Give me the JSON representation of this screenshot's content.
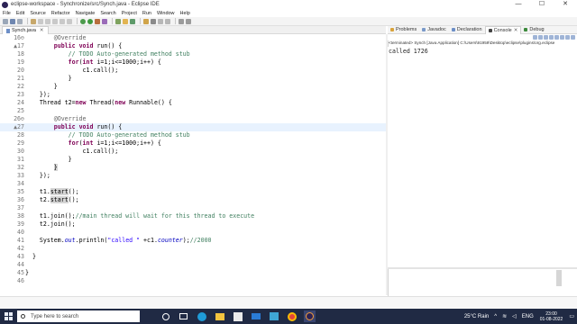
{
  "window": {
    "title": "eclipse-workspace - Synchronize/src/Synch.java - Eclipse IDE",
    "controls": [
      "—",
      "☐",
      "✕"
    ]
  },
  "menubar": [
    "File",
    "Edit",
    "Source",
    "Refactor",
    "Navigate",
    "Search",
    "Project",
    "Run",
    "Window",
    "Help"
  ],
  "editor": {
    "tab_label": "Synch.java",
    "tab_close": "✕",
    "lines": [
      {
        "num": "16⊖",
        "indent": "        ",
        "segs": [
          {
            "t": "@Override",
            "c": "ann"
          }
        ]
      },
      {
        "num": "▲17",
        "indent": "        ",
        "segs": [
          {
            "t": "public",
            "c": "kw"
          },
          {
            "t": " "
          },
          {
            "t": "void",
            "c": "kw"
          },
          {
            "t": " run() {"
          }
        ]
      },
      {
        "num": "18",
        "indent": "            ",
        "segs": [
          {
            "t": "// TODO Auto-generated method stub",
            "c": "cmt"
          }
        ]
      },
      {
        "num": "19",
        "indent": "            ",
        "segs": [
          {
            "t": "for",
            "c": "kw"
          },
          {
            "t": "("
          },
          {
            "t": "int",
            "c": "kw"
          },
          {
            "t": " i=1;i<=1000;i++) {"
          }
        ]
      },
      {
        "num": "20",
        "indent": "                ",
        "segs": [
          {
            "t": "c1.call();"
          }
        ]
      },
      {
        "num": "21",
        "indent": "            ",
        "segs": [
          {
            "t": "}"
          }
        ]
      },
      {
        "num": "22",
        "indent": "        ",
        "segs": [
          {
            "t": "}"
          }
        ]
      },
      {
        "num": "23",
        "indent": "    ",
        "segs": [
          {
            "t": "});"
          }
        ]
      },
      {
        "num": "24",
        "indent": "    ",
        "segs": [
          {
            "t": "Thread t2="
          },
          {
            "t": "new",
            "c": "kw"
          },
          {
            "t": " Thread("
          },
          {
            "t": "new",
            "c": "kw"
          },
          {
            "t": " Runnable() {"
          }
        ]
      },
      {
        "num": "25",
        "indent": "",
        "segs": []
      },
      {
        "num": "26⊖",
        "indent": "        ",
        "segs": [
          {
            "t": "@Override",
            "c": "ann"
          }
        ]
      },
      {
        "num": "▲27",
        "indent": "        ",
        "segs": [
          {
            "t": "public",
            "c": "kw"
          },
          {
            "t": " "
          },
          {
            "t": "void",
            "c": "kw"
          },
          {
            "t": " run() {"
          }
        ]
      },
      {
        "num": "28",
        "indent": "            ",
        "segs": [
          {
            "t": "// TODO Auto-generated method stub",
            "c": "cmt"
          }
        ]
      },
      {
        "num": "29",
        "indent": "            ",
        "segs": [
          {
            "t": "for",
            "c": "kw"
          },
          {
            "t": "("
          },
          {
            "t": "int",
            "c": "kw"
          },
          {
            "t": " i=1;i<=1000;i++) {"
          }
        ]
      },
      {
        "num": "30",
        "indent": "                ",
        "segs": [
          {
            "t": "c1.call();"
          }
        ]
      },
      {
        "num": "31",
        "indent": "            ",
        "segs": [
          {
            "t": "}"
          }
        ]
      },
      {
        "num": "32",
        "indent": "        ",
        "segs": [
          {
            "t": "}",
            "c": "hl"
          }
        ]
      },
      {
        "num": "33",
        "indent": "    ",
        "segs": [
          {
            "t": "});"
          }
        ]
      },
      {
        "num": "34",
        "indent": "",
        "segs": []
      },
      {
        "num": "35",
        "indent": "    ",
        "segs": [
          {
            "t": "t1."
          },
          {
            "t": "start",
            "c": "hl"
          },
          {
            "t": "();"
          }
        ]
      },
      {
        "num": "36",
        "indent": "    ",
        "segs": [
          {
            "t": "t2."
          },
          {
            "t": "start",
            "c": "hl"
          },
          {
            "t": "();"
          }
        ]
      },
      {
        "num": "37",
        "indent": "",
        "segs": []
      },
      {
        "num": "38",
        "indent": "    ",
        "segs": [
          {
            "t": "t1.join();"
          },
          {
            "t": "//main thread will wait for this thread to execute",
            "c": "cmt"
          }
        ]
      },
      {
        "num": "39",
        "indent": "    ",
        "segs": [
          {
            "t": "t2.join();"
          }
        ]
      },
      {
        "num": "40",
        "indent": "",
        "segs": []
      },
      {
        "num": "41",
        "indent": "    ",
        "segs": [
          {
            "t": "System."
          },
          {
            "t": "out",
            "c": "fld"
          },
          {
            "t": ".println("
          },
          {
            "t": "\"called \"",
            "c": "str"
          },
          {
            "t": " +c1."
          },
          {
            "t": "counter",
            "c": "fld"
          },
          {
            "t": ");"
          },
          {
            "t": "//2000",
            "c": "cmt"
          }
        ]
      },
      {
        "num": "42",
        "indent": "",
        "segs": []
      },
      {
        "num": "43",
        "indent": "  ",
        "segs": [
          {
            "t": "}"
          }
        ]
      },
      {
        "num": "44",
        "indent": "",
        "segs": []
      },
      {
        "num": "45",
        "indent": "}",
        "segs": []
      },
      {
        "num": "46",
        "indent": "",
        "segs": []
      }
    ]
  },
  "views": {
    "tabs": [
      {
        "label": "Problems",
        "icon_color": "#d9a33b",
        "active": false
      },
      {
        "label": "Javadoc",
        "icon_color": "#7a9ac9",
        "active": false
      },
      {
        "label": "Declaration",
        "icon_color": "#6d8fc7",
        "active": false
      },
      {
        "label": "Console",
        "icon_color": "#444444",
        "active": true
      },
      {
        "label": "Debug",
        "icon_color": "#3c8a3c",
        "active": false
      }
    ],
    "console_status": "<terminated> Synch [Java Application] C:\\Users\\91959\\Desktop\\eclipse\\plugins\\org.eclipse",
    "console_output": "called 1726"
  },
  "taskbar": {
    "search_placeholder": "Type here to search",
    "weather": "25°C  Rain",
    "tray_arrow": "^",
    "language": "ENG",
    "time": "23:00",
    "date": "01-08-2022"
  },
  "colors": {
    "keyword": "#7f0055",
    "comment": "#3f7f5f",
    "string": "#2a00ff",
    "field": "#0000c0",
    "current_line": "#e8f2fe",
    "taskbar": "#202a44"
  }
}
